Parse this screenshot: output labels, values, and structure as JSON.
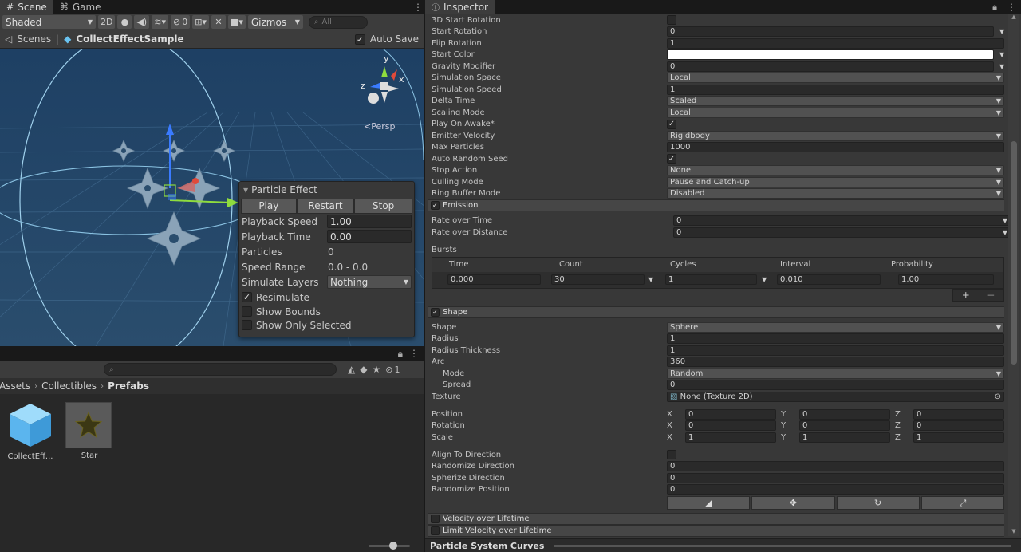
{
  "scene": {
    "tabs": [
      {
        "label": "Scene",
        "icon": "grid-icon"
      },
      {
        "label": "Game",
        "icon": "gamepad-icon"
      }
    ],
    "toolbar": {
      "shading": "Shaded",
      "mode_2d": "2D",
      "hidden_count": "0",
      "gizmos": "Gizmos",
      "search_placeholder": "All"
    },
    "breadcrumb": {
      "scenes": "Scenes",
      "object": "CollectEffectSample",
      "auto_save": "Auto Save",
      "auto_save_checked": true
    },
    "persp_label": "Persp",
    "axis_labels": {
      "x": "x",
      "y": "y",
      "z": "z"
    },
    "particle_effect": {
      "title": "Particle Effect",
      "buttons": [
        "Play",
        "Restart",
        "Stop"
      ],
      "rows": [
        {
          "label": "Playback Speed",
          "value": "1.00",
          "kind": "input"
        },
        {
          "label": "Playback Time",
          "value": "0.00",
          "kind": "input"
        },
        {
          "label": "Particles",
          "value": "0",
          "kind": "text"
        },
        {
          "label": "Speed Range",
          "value": "0.0 - 0.0",
          "kind": "text"
        },
        {
          "label": "Simulate Layers",
          "value": "Nothing",
          "kind": "dropdown"
        }
      ],
      "checks": [
        {
          "label": "Resimulate",
          "checked": true
        },
        {
          "label": "Show Bounds",
          "checked": false
        },
        {
          "label": "Show Only Selected",
          "checked": false
        }
      ]
    }
  },
  "project": {
    "hidden_count": "1",
    "breadcrumb": [
      "Assets",
      "Collectibles",
      "Prefabs"
    ],
    "assets": [
      {
        "name": "CollectEff...",
        "icon": "cube-prefab-icon"
      },
      {
        "name": "Star",
        "icon": "star-icon"
      }
    ]
  },
  "inspector": {
    "tab_label": "Inspector",
    "main_rows": [
      {
        "label": "3D Start Rotation",
        "kind": "check",
        "checked": false
      },
      {
        "label": "Start Rotation",
        "kind": "num_dd",
        "value": "0"
      },
      {
        "label": "Flip Rotation",
        "kind": "num",
        "value": "1"
      },
      {
        "label": "Start Color",
        "kind": "color",
        "value": "#ffffff"
      },
      {
        "label": "Gravity Modifier",
        "kind": "num_dd",
        "value": "0"
      },
      {
        "label": "Simulation Space",
        "kind": "dropdown",
        "value": "Local"
      },
      {
        "label": "Simulation Speed",
        "kind": "num",
        "value": "1"
      },
      {
        "label": "Delta Time",
        "kind": "dropdown",
        "value": "Scaled"
      },
      {
        "label": "Scaling Mode",
        "kind": "dropdown",
        "value": "Local"
      },
      {
        "label": "Play On Awake*",
        "kind": "check",
        "checked": true
      },
      {
        "label": "Emitter Velocity",
        "kind": "dropdown",
        "value": "Rigidbody"
      },
      {
        "label": "Max Particles",
        "kind": "num",
        "value": "1000"
      },
      {
        "label": "Auto Random Seed",
        "kind": "check",
        "checked": true
      },
      {
        "label": "Stop Action",
        "kind": "dropdown",
        "value": "None"
      },
      {
        "label": "Culling Mode",
        "kind": "dropdown",
        "value": "Pause and Catch-up"
      },
      {
        "label": "Ring Buffer Mode",
        "kind": "dropdown",
        "value": "Disabled"
      }
    ],
    "emission": {
      "title": "Emission",
      "enabled": true,
      "rows": [
        {
          "label": "Rate over Time",
          "value": "0"
        },
        {
          "label": "Rate over Distance",
          "value": "0"
        }
      ],
      "bursts_label": "Bursts",
      "burst_headers": [
        "Time",
        "Count",
        "Cycles",
        "Interval",
        "Probability"
      ],
      "burst_row": [
        "0.000",
        "30",
        "1",
        "0.010",
        "1.00"
      ],
      "add_label": "+",
      "remove_label": "−"
    },
    "shape": {
      "title": "Shape",
      "enabled": true,
      "rows": [
        {
          "label": "Shape",
          "kind": "dropdown",
          "value": "Sphere"
        },
        {
          "label": "Radius",
          "kind": "num",
          "value": "1"
        },
        {
          "label": "Radius Thickness",
          "kind": "num",
          "value": "1"
        },
        {
          "label": "Arc",
          "kind": "num",
          "value": "360"
        },
        {
          "label": "Mode",
          "kind": "dropdown",
          "value": "Random",
          "indent": true
        },
        {
          "label": "Spread",
          "kind": "num",
          "value": "0",
          "indent": true
        },
        {
          "label": "Texture",
          "kind": "object",
          "value": "None (Texture 2D)"
        }
      ],
      "transform": [
        {
          "label": "Position",
          "x": "0",
          "y": "0",
          "z": "0"
        },
        {
          "label": "Rotation",
          "x": "0",
          "y": "0",
          "z": "0"
        },
        {
          "label": "Scale",
          "x": "1",
          "y": "1",
          "z": "1"
        }
      ],
      "axis": [
        "X",
        "Y",
        "Z"
      ],
      "extra_rows": [
        {
          "label": "Align To Direction",
          "kind": "check",
          "checked": false
        },
        {
          "label": "Randomize Direction",
          "kind": "num",
          "value": "0"
        },
        {
          "label": "Spherize Direction",
          "kind": "num",
          "value": "0"
        },
        {
          "label": "Randomize Position",
          "kind": "num",
          "value": "0"
        }
      ]
    },
    "modules": [
      {
        "title": "Velocity over Lifetime",
        "enabled": false
      },
      {
        "title": "Limit Velocity over Lifetime",
        "enabled": false
      }
    ],
    "curves_label": "Particle System Curves"
  }
}
